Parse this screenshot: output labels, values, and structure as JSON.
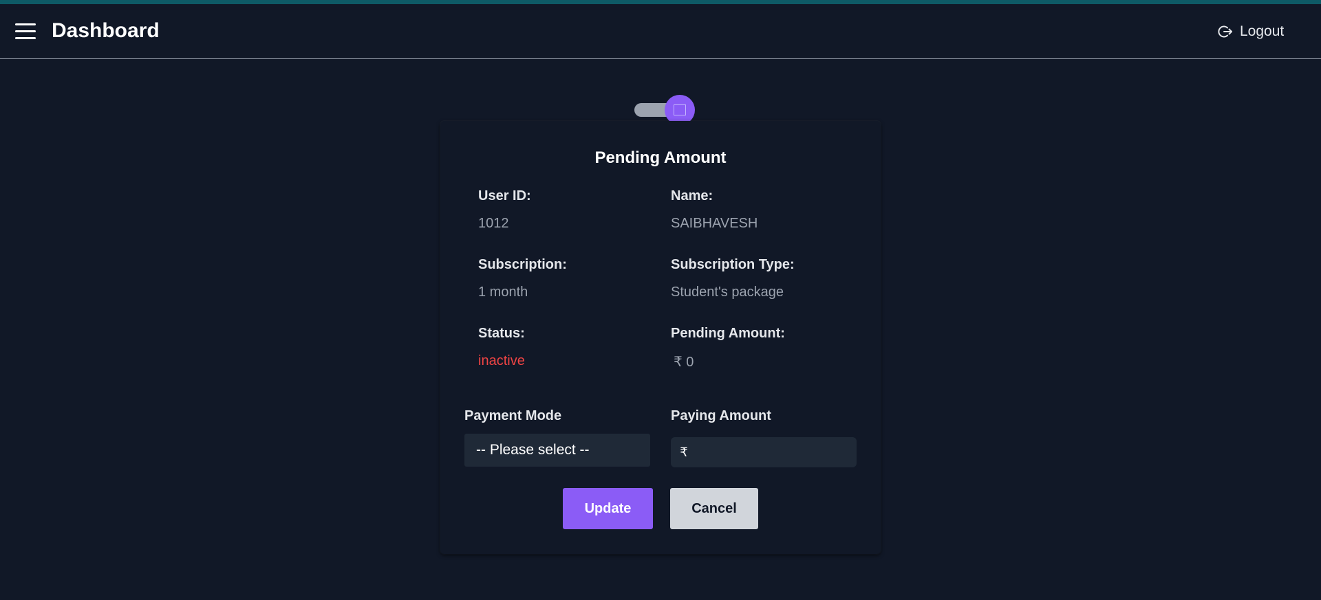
{
  "header": {
    "title": "Dashboard",
    "logout_label": "Logout"
  },
  "toggle": {
    "state": "on",
    "accent": "#8b5cf6"
  },
  "card": {
    "title": "Pending Amount",
    "fields": [
      {
        "label": "User ID:",
        "value": "1012"
      },
      {
        "label": "Name:",
        "value": "SAIBHAVESH"
      },
      {
        "label": "Subscription:",
        "value": "1 month"
      },
      {
        "label": "Subscription Type:",
        "value": "Student's package"
      },
      {
        "label": "Status:",
        "value": "inactive"
      },
      {
        "label": "Pending Amount:",
        "value": "₹ 0"
      }
    ],
    "payment_mode": {
      "label": "Payment Mode",
      "selected": "-- Please select --"
    },
    "paying_amount": {
      "label": "Paying Amount",
      "currency_symbol": "₹",
      "value": ""
    },
    "update_label": "Update",
    "cancel_label": "Cancel"
  },
  "colors": {
    "background": "#111827",
    "accent": "#8b5cf6",
    "status_inactive": "#ef4444",
    "top_accent": "#0e5a66"
  },
  "icons": [
    "menu-icon",
    "logout-icon"
  ]
}
